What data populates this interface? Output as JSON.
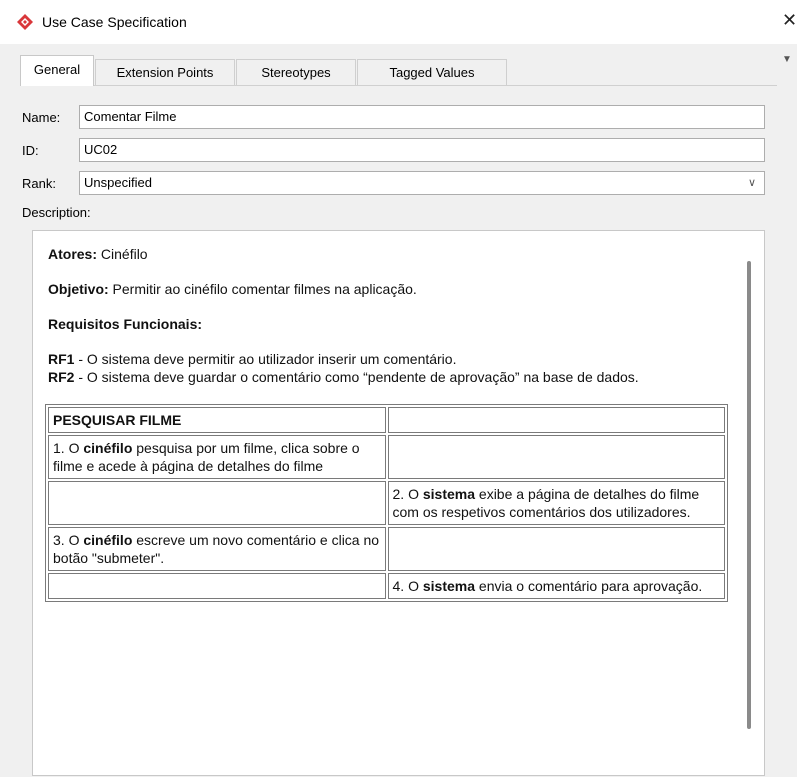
{
  "window": {
    "title": "Use Case Specification",
    "close_glyph": "✕",
    "menu_glyph": "▼",
    "icon": "diamond-logo-icon"
  },
  "tabs": [
    {
      "label": "General",
      "active": true
    },
    {
      "label": "Extension Points",
      "active": false
    },
    {
      "label": "Stereotypes",
      "active": false
    },
    {
      "label": "Tagged Values",
      "active": false
    }
  ],
  "form": {
    "name_label": "Name:",
    "name_value": "Comentar Filme",
    "id_label": "ID:",
    "id_value": "UC02",
    "rank_label": "Rank:",
    "rank_value": "Unspecified",
    "description_label": "Description:"
  },
  "description": {
    "actors_label": "Atores:",
    "actors_value": " Cinéfilo",
    "objective_label": "Objetivo:",
    "objective_value": " Permitir ao cinéfilo comentar filmes na aplicação.",
    "requirements_heading": "Requisitos Funcionais:",
    "requirements": [
      {
        "id": "RF1",
        "text": " - O sistema deve permitir ao utilizador inserir um comentário."
      },
      {
        "id": "RF2",
        "text": " - O sistema deve guardar o comentário como “pendente de aprovação” na base de dados."
      }
    ],
    "table": {
      "header": "PESQUISAR FILME",
      "steps": [
        {
          "pre": "1. O ",
          "bold": "cinéfilo",
          "post": " pesquisa por um filme, clica sobre o filme e acede à página de detalhes do filme"
        },
        {
          "pre": "2. O ",
          "bold": "sistema",
          "post": " exibe a página de detalhes do filme com os respetivos comentários dos utilizadores."
        },
        {
          "pre": "3. O ",
          "bold": "cinéfilo",
          "post": " escreve um novo comentário e clica no botão \"submeter\"."
        },
        {
          "pre": "4. O ",
          "bold": "sistema",
          "post": " envia o comentário para aprovação."
        }
      ]
    }
  },
  "colors": {
    "icon_red": "#d9373a",
    "window_bg": "#f0f0f0"
  }
}
